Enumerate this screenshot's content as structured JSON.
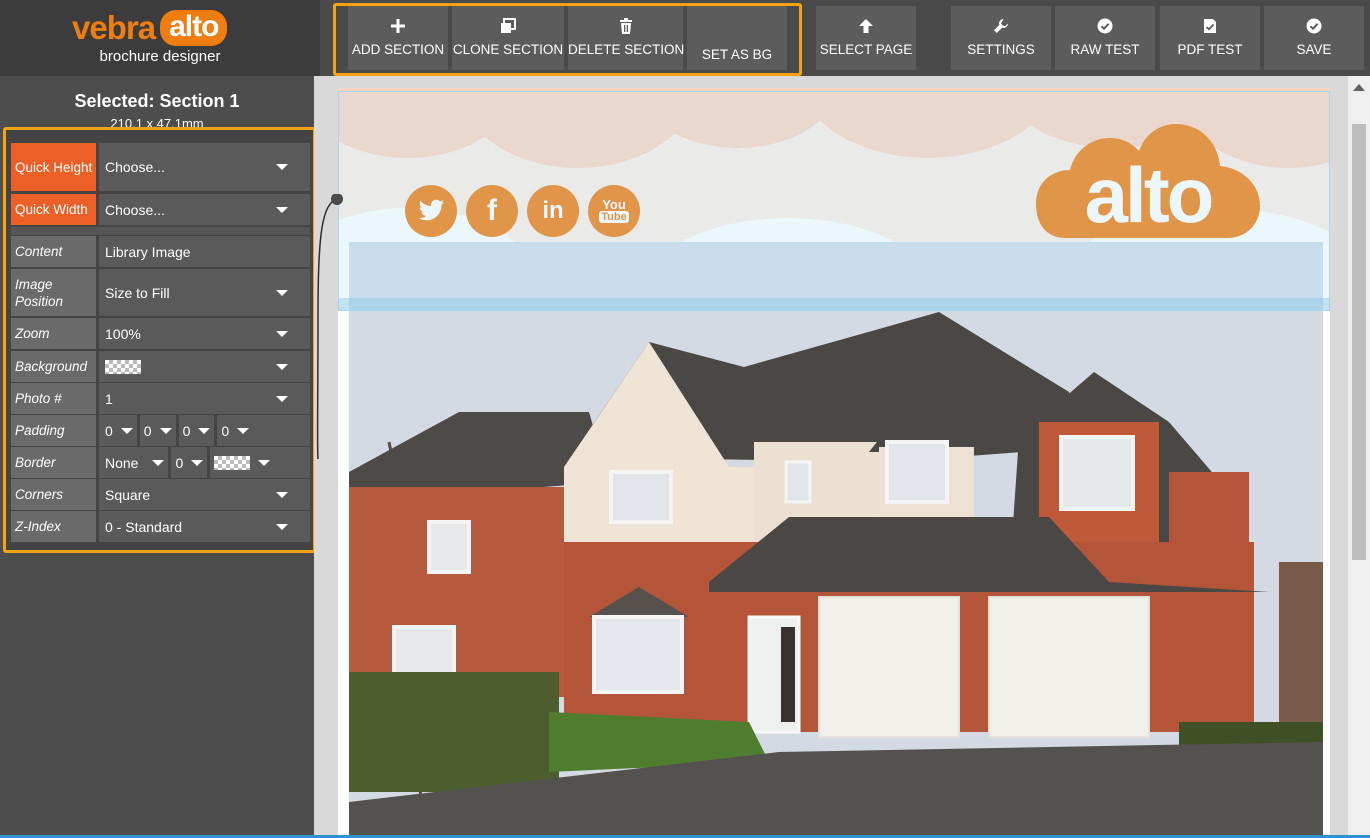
{
  "app": {
    "brand_vebra": "vebra",
    "brand_alto": "alto",
    "subtitle": "brochure designer"
  },
  "toolbar": {
    "add_section": "ADD SECTION",
    "clone_section": "CLONE SECTION",
    "delete_section": "DELETE SECTION",
    "set_as_bg": "SET AS BG",
    "select_page": "SELECT PAGE",
    "settings": "SETTINGS",
    "raw_test": "RAW TEST",
    "pdf_test": "PDF TEST",
    "save": "SAVE"
  },
  "panel": {
    "selected_title": "Selected: Section 1",
    "dimensions": "210.1 x 47.1mm",
    "quick_height": {
      "label": "Quick Height",
      "value": "Choose..."
    },
    "quick_width": {
      "label": "Quick Width",
      "value": "Choose..."
    },
    "content": {
      "label": "Content",
      "value": "Library Image"
    },
    "image_position": {
      "label": "Image Position",
      "value": "Size to Fill"
    },
    "zoom": {
      "label": "Zoom",
      "value": "100%"
    },
    "background": {
      "label": "Background"
    },
    "photo_number": {
      "label": "Photo #",
      "value": "1"
    },
    "padding": {
      "label": "Padding",
      "top": "0",
      "right": "0",
      "bottom": "0",
      "left": "0"
    },
    "border": {
      "label": "Border",
      "style": "None",
      "width": "0"
    },
    "corners": {
      "label": "Corners",
      "value": "Square"
    },
    "z_index": {
      "label": "Z-Index",
      "value": "0 - Standard"
    }
  },
  "canvas": {
    "header_logo": "alto",
    "social_icons": [
      "twitter-icon",
      "facebook-icon",
      "linkedin-icon",
      "youtube-icon"
    ],
    "youtube_text_1": "You",
    "youtube_text_2": "Tube"
  },
  "colors": {
    "accent_orange": "#ef7d10",
    "highlight_border": "#f6a313",
    "label_orange": "#ec5f26",
    "toolbar_bg": "#4a4a4a"
  }
}
